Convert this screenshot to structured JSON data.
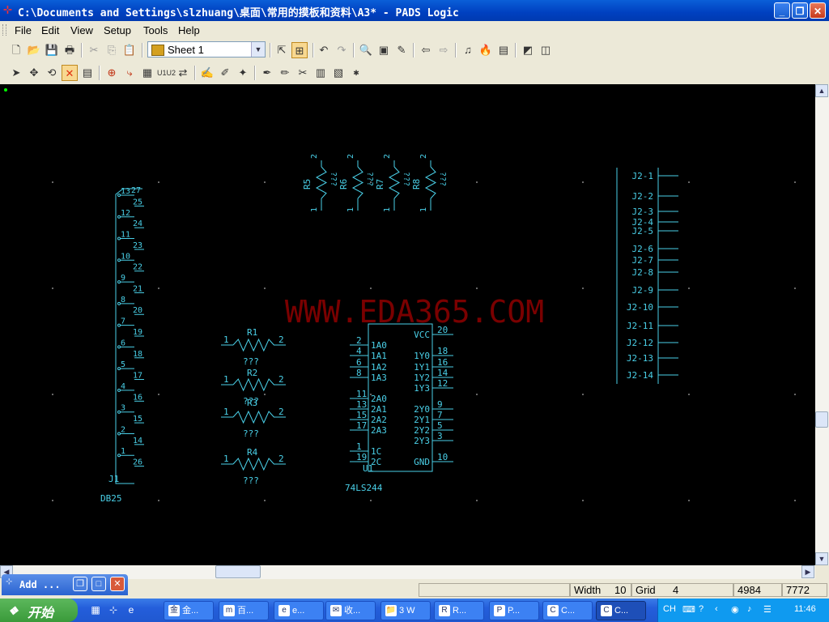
{
  "titlebar": {
    "title": "C:\\Documents and Settings\\slzhuang\\桌面\\常用的摸板和资料\\A3* - PADS Logic",
    "minimize": "_",
    "restore": "❐",
    "close": "✕"
  },
  "menu": {
    "file": "File",
    "edit": "Edit",
    "view": "View",
    "setup": "Setup",
    "tools": "Tools",
    "help": "Help"
  },
  "sheet_selector": {
    "value": "Sheet 1"
  },
  "schematic": {
    "watermark": "WWW.EDA365.COM",
    "db25": {
      "label": "DB25",
      "ref": "J1",
      "pins": [
        "13",
        "25",
        "12",
        "24",
        "11",
        "23",
        "10",
        "22",
        "9",
        "21",
        "8",
        "20",
        "7",
        "19",
        "6",
        "18",
        "5",
        "17",
        "4",
        "16",
        "3",
        "15",
        "2",
        "14",
        "1",
        "26",
        "27"
      ]
    },
    "resistors_top": [
      {
        "ref": "R5",
        "value": "???",
        "pin1": "1",
        "pin2": "2"
      },
      {
        "ref": "R6",
        "value": "???",
        "pin1": "1",
        "pin2": "2"
      },
      {
        "ref": "R7",
        "value": "???",
        "pin1": "1",
        "pin2": "2"
      },
      {
        "ref": "R8",
        "value": "???",
        "pin1": "1",
        "pin2": "2"
      }
    ],
    "resistors_left": [
      {
        "ref": "R1",
        "value": "???",
        "pin1": "1",
        "pin2": "2"
      },
      {
        "ref": "R2",
        "value": "???",
        "pin1": "1",
        "pin2": "2"
      },
      {
        "ref": "R3",
        "value": "???",
        "pin1": "1",
        "pin2": "2"
      },
      {
        "ref": "R4",
        "value": "???",
        "pin1": "1",
        "pin2": "2"
      }
    ],
    "ic": {
      "ref": "U1",
      "part": "74LS244",
      "left_pins": [
        [
          "2",
          "1A0"
        ],
        [
          "4",
          "1A1"
        ],
        [
          "6",
          "1A2"
        ],
        [
          "8",
          "1A3"
        ],
        [
          "11",
          "2A0"
        ],
        [
          "13",
          "2A1"
        ],
        [
          "15",
          "2A2"
        ],
        [
          "17",
          "2A3"
        ],
        [
          "1",
          "1C"
        ],
        [
          "19",
          "2C"
        ]
      ],
      "right_pins": [
        [
          "20",
          "VCC"
        ],
        [
          "18",
          "1Y0"
        ],
        [
          "16",
          "1Y1"
        ],
        [
          "14",
          "1Y2"
        ],
        [
          "12",
          "1Y3"
        ],
        [
          "9",
          "2Y0"
        ],
        [
          "7",
          "2Y1"
        ],
        [
          "5",
          "2Y2"
        ],
        [
          "3",
          "2Y3"
        ],
        [
          "10",
          "GND"
        ]
      ]
    },
    "j2": {
      "pins": [
        "J2-1",
        "J2-2",
        "J2-3",
        "J2-4",
        "J2-5",
        "J2-6",
        "J2-7",
        "J2-8",
        "J2-9",
        "J2-10",
        "J2-11",
        "J2-12",
        "J2-13",
        "J2-14"
      ]
    }
  },
  "status": {
    "width_label": "Width",
    "width_value": "10",
    "grid_label": "Grid",
    "grid_value": "4",
    "x": "4984",
    "y": "7772"
  },
  "add_window": {
    "label": "Add ..."
  },
  "taskbar": {
    "start": "开始",
    "tasks": [
      "金...",
      "百...",
      "e...",
      "收...",
      "3 W",
      "R...",
      "P...",
      "C...",
      "C..."
    ],
    "lang": "CH",
    "clock": "11:46"
  }
}
